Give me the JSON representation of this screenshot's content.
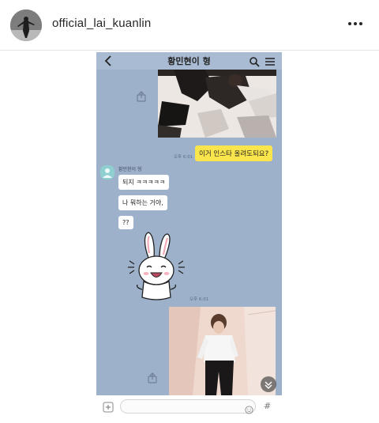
{
  "post": {
    "username": "official_lai_kuanlin"
  },
  "chat": {
    "title": "황민현이 형",
    "friend_name": "황민현이 형",
    "time_photo1": "오후 6:01",
    "time_me": "오후 6:01",
    "time_sticker": "오후 6:01",
    "my_message": "이거 인스타 올려도되요?",
    "replies": [
      "되지 ㅋㅋㅋㅋㅋ",
      "나 뭐하는 거야,",
      "??"
    ],
    "input_hash": "#"
  },
  "colors": {
    "chat_background": "#9db1cb",
    "my_bubble": "#fae54c",
    "friend_avatar": "#8fcfd0"
  },
  "icons": [
    "ellipsis-icon",
    "back-arrow-icon",
    "search-icon",
    "menu-icon",
    "share-icon",
    "plus-icon",
    "emoji-icon",
    "scroll-down-icon"
  ]
}
